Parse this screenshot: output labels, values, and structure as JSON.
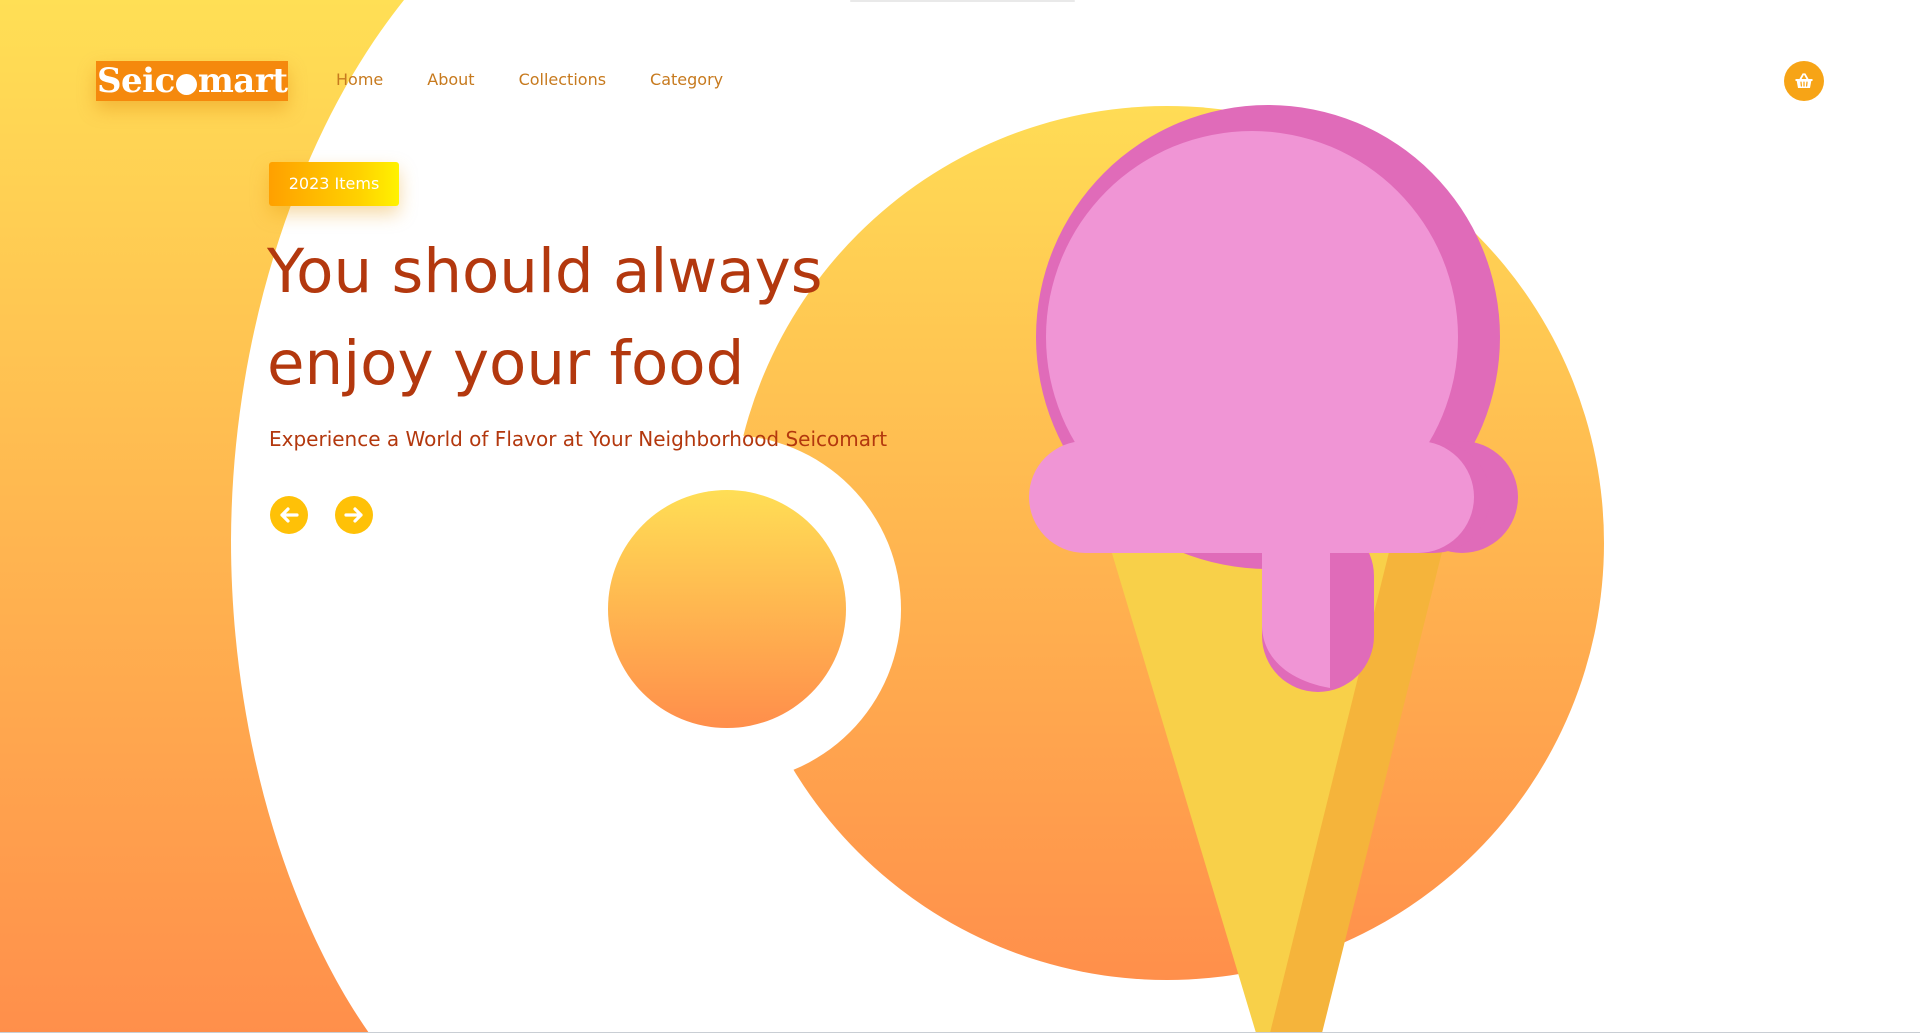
{
  "brand": {
    "logo_before": "Seic",
    "logo_after": "mart"
  },
  "nav": {
    "items": [
      "Home",
      "About",
      "Collections",
      "Category"
    ]
  },
  "header": {
    "cart_icon": "shopping-basket-icon"
  },
  "hero": {
    "badge": "2023 Items",
    "headline_line1": "You should always",
    "headline_line2": "enjoy your food",
    "subtitle": "Experience a World of Flavor at Your Neighborhood Seicomart",
    "prev_icon": "arrow-left-icon",
    "next_icon": "arrow-right-icon"
  },
  "colors": {
    "accent_orange": "#f5890d",
    "gradient_top": "#ffdd55",
    "gradient_bottom": "#ff8c4b",
    "heading_text": "#b3380e",
    "nav_text": "#c77a1e",
    "scoop_pink": "#f095d5",
    "scoop_shadow": "#e06bb9",
    "cone_yellow": "#f8d049",
    "cone_shadow": "#f5b43b",
    "button_yellow": "#ffc107"
  }
}
